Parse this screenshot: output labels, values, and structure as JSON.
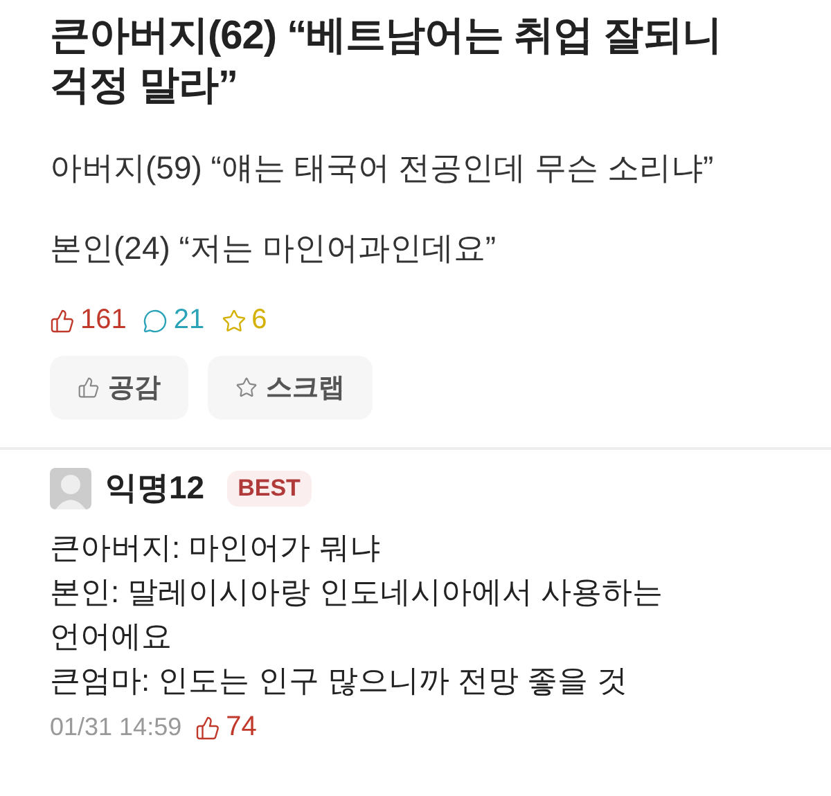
{
  "post": {
    "title": "큰아버지(62) “베트남어는 취업 잘되니 걱정 말라”",
    "lines": [
      "아버지(59) “얘는 태국어 전공인데 무슨 소리냐”",
      "본인(24) “저는 마인어과인데요”"
    ],
    "stats": [
      {
        "kind": "like",
        "count": "161"
      },
      {
        "kind": "comment",
        "count": "21"
      },
      {
        "kind": "scrap",
        "count": "6"
      }
    ],
    "buttons": [
      {
        "kind": "like",
        "label": "공감"
      },
      {
        "kind": "scrap",
        "label": "스크랩"
      }
    ]
  },
  "comment": {
    "author": "익명12",
    "badge": "BEST",
    "lines": [
      "큰아버지: 마인어가 뭐냐",
      "본인: 말레이시아랑 인도네시아에서 사용하는 언어에요",
      "큰엄마: 인도는 인구 많으니까 전망 좋을 것"
    ],
    "date": "01/31 14:59",
    "likes": "74"
  }
}
